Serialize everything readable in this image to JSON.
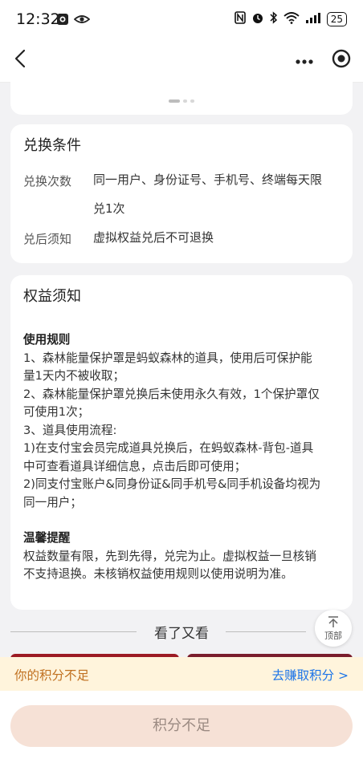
{
  "status_bar": {
    "time": "12:32",
    "battery": "25",
    "signal_label": "6"
  },
  "nav": {
    "back_icon": "chevron-left-icon",
    "more_icon": "more-icon",
    "target_icon": "record-icon"
  },
  "exchange_conditions": {
    "title": "兑换条件",
    "rows": [
      {
        "label": "兑换次数",
        "value_lines": [
          "同一用户、身份证号、手机号、终端每天限",
          "兑1次"
        ]
      },
      {
        "label": "兑后须知",
        "value_lines": [
          "虚拟权益兑后不可退换"
        ]
      }
    ]
  },
  "rights_notice": {
    "title": "权益须知",
    "usage_heading": "使用规则",
    "usage_lines": [
      "1、森林能量保护罩是蚂蚁森林的道具，使用后可保护能",
      "量1天内不被收取；",
      "2、森林能量保护罩兑换后未使用永久有效，1个保护罩仅",
      "可使用1次；",
      "3、道具使用流程:",
      "1)在支付宝会员完成道具兑换后，在蚂蚁森林-背包-道具",
      "中可查看道具详细信息，点击后即可使用；",
      "2)同支付宝账户&同身份证&同手机号&同手机设备均视为",
      "同一用户；"
    ],
    "tips_heading": "温馨提醒",
    "tips_lines": [
      "权益数量有限，先到先得，兑完为止。虚拟权益一旦核销",
      "不支持退换。未核销权益使用规则以使用说明为准。"
    ]
  },
  "recommend": {
    "divider_text": "看了又看",
    "top_button_label": "顶部"
  },
  "points_bar": {
    "message": "你的积分不足",
    "earn_link": "去赚取积分 >"
  },
  "footer": {
    "button_label": "积分不足"
  },
  "colors": {
    "accent_link": "#1a73e8",
    "warning_text": "#c0701f",
    "points_bar_bg": "#fff4dc",
    "button_bg": "#f6e1d6"
  }
}
